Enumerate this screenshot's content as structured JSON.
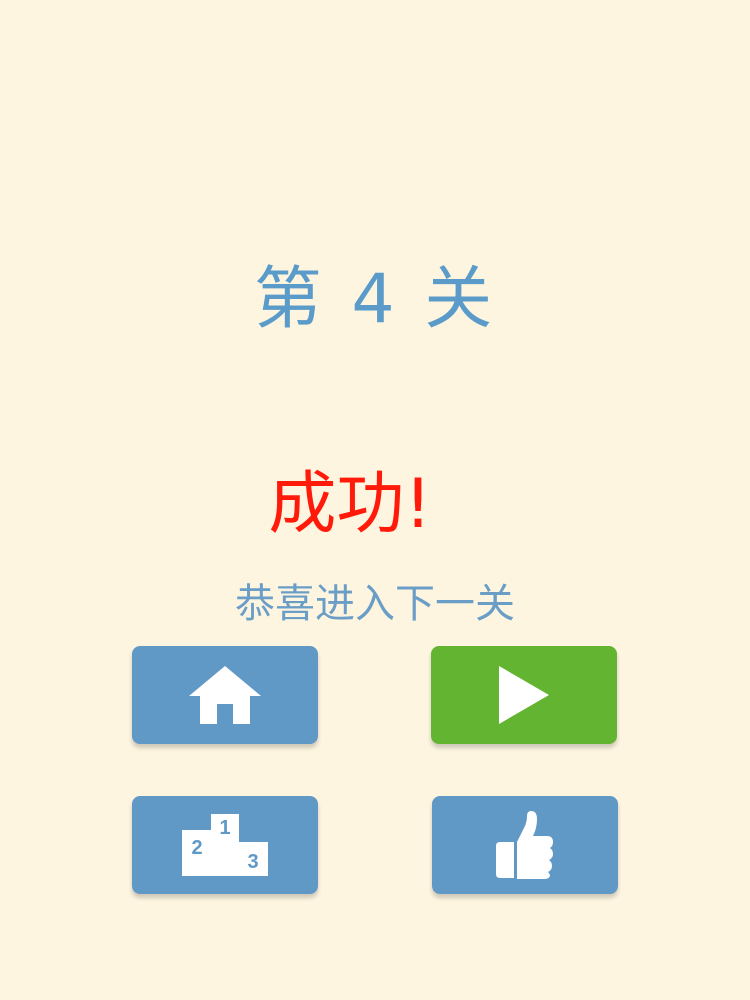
{
  "level": {
    "title": "第 4 关"
  },
  "result": {
    "title": "成功!",
    "subtitle": "恭喜进入下一关"
  },
  "buttons": {
    "home": {
      "icon": "home-icon"
    },
    "play": {
      "icon": "play-icon"
    },
    "ranking": {
      "icon": "podium-icon",
      "place_1": "1",
      "place_2": "2",
      "place_3": "3"
    },
    "like": {
      "icon": "thumbs-up-icon"
    }
  },
  "colors": {
    "background": "#fdf5e0",
    "level_title": "#5b9bc9",
    "success": "#ff1a0a",
    "subtitle": "#6a9ec7",
    "button_blue": "#6199c6",
    "button_green": "#63b531",
    "icon": "#ffffff"
  }
}
